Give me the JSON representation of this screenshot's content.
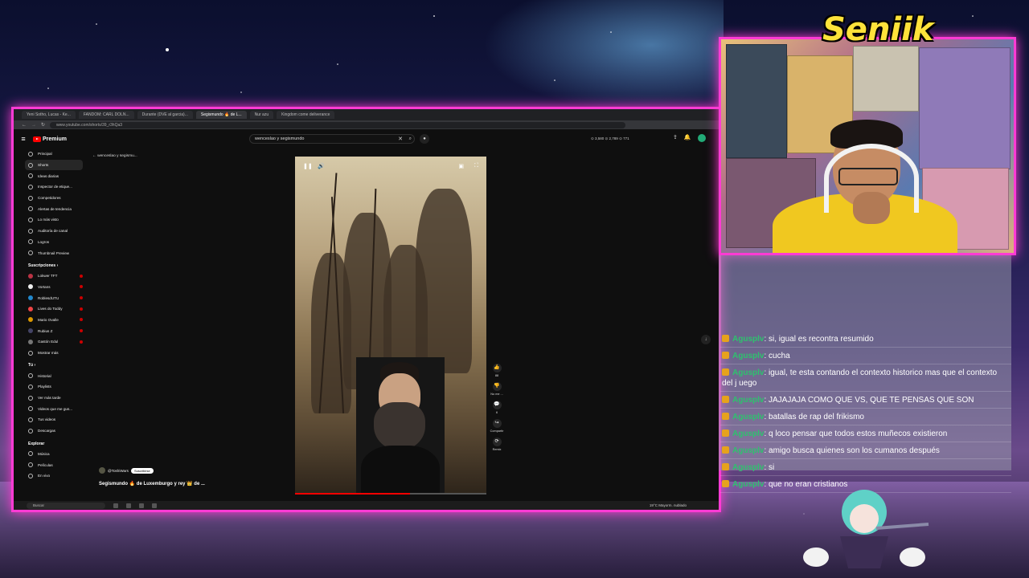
{
  "overlay": {
    "streamer_name": "Seniik"
  },
  "browser": {
    "tabs": [
      {
        "label": "Yeni Sotho, Lucas - Ke...",
        "active": false
      },
      {
        "label": "FANDOM: CARL DOLN...",
        "active": false
      },
      {
        "label": "Durante (DVE al garcia)...",
        "active": false
      },
      {
        "label": "Segismundo 🔥 de L...",
        "active": true
      },
      {
        "label": "Nur azu",
        "active": false
      },
      {
        "label": "Kingdom come deliverance",
        "active": false
      }
    ],
    "url": "www.youtube.com/shorts/39_r3hQa3"
  },
  "youtube": {
    "brand": "Premium",
    "search_value": "wenceslao y segismundo",
    "stats": "⊙ 3,580  ⊙ 2,789  ⊙ 771",
    "back_label": "wenceslao y segismu...",
    "sidebar": {
      "items": [
        {
          "label": "Principal",
          "active": false
        },
        {
          "label": "Shorts",
          "active": true
        },
        {
          "label": "Ideas diarias",
          "active": false
        },
        {
          "label": "Inspector de etique...",
          "active": false
        },
        {
          "label": "Competidores",
          "active": false
        },
        {
          "label": "Alertas de tendencia",
          "active": false
        },
        {
          "label": "Lo más visto",
          "active": false
        },
        {
          "label": "Auditoría de canal",
          "active": false
        },
        {
          "label": "Logros",
          "active": false
        },
        {
          "label": "Thumbnail Preview",
          "active": false
        }
      ],
      "subs_header": "Suscripciones  ›",
      "subs": [
        {
          "label": "Lokwer TFT",
          "color": "#b34"
        },
        {
          "label": "Vortans",
          "color": "#eee"
        },
        {
          "label": "RoblesdUTU",
          "color": "#28c"
        },
        {
          "label": "Lives do Toddy",
          "color": "#e44"
        },
        {
          "label": "Mario Ovalle",
          "color": "#d90"
        },
        {
          "label": "Rubius Z",
          "color": "#446"
        },
        {
          "label": "Gastón Edul",
          "color": "#777"
        }
      ],
      "show_more": "Mostrar más",
      "you_header": "Tú  ›",
      "you_items": [
        "Historial",
        "Playlists",
        "Ver más tarde",
        "Videos que me gus...",
        "Tus videos",
        "Descargas"
      ],
      "explore_header": "Explorar",
      "explore_items": [
        "Música",
        "Películas",
        "En vivo"
      ]
    },
    "short": {
      "channel": "@ToshiWars",
      "subscribe": "Suscribirse",
      "title": "Segismundo 🔥 de Luxemburgo y rey 👑 de ...",
      "actions": [
        {
          "icon": "like-icon",
          "label": "88"
        },
        {
          "icon": "dislike-icon",
          "label": "No me ..."
        },
        {
          "icon": "comment-icon",
          "label": "6"
        },
        {
          "icon": "share-icon",
          "label": "Compartir"
        },
        {
          "icon": "remix-icon",
          "label": "Remix"
        }
      ]
    }
  },
  "taskbar": {
    "search": "Buscar",
    "weather": "19°C  Mayorm. nublado"
  },
  "chat": [
    {
      "user": "Agusplv",
      "text": "si, igual es recontra resumido"
    },
    {
      "user": "Agusplv",
      "text": "cucha"
    },
    {
      "user": "Agusplv",
      "text": "igual, te esta contando el contexto historico mas que el contexto del j uego"
    },
    {
      "user": "Agusplv",
      "text": "JAJAJAJA COMO QUE VS, QUE TE PENSAS QUE SON"
    },
    {
      "user": "Agusplv",
      "text": "batallas de rap del frikismo"
    },
    {
      "user": "Agusplv",
      "text": "q loco pensar que todos estos muñecos existieron"
    },
    {
      "user": "Agusplv",
      "text": "amigo busca quienes son los cumanos después"
    },
    {
      "user": "Agusplv",
      "text": "si"
    },
    {
      "user": "Agusplv",
      "text": "que no eran cristianos"
    }
  ],
  "colors": {
    "frame": "#ff3bd4",
    "chat_user": "#2ec26e",
    "name": "#ffe23a"
  }
}
